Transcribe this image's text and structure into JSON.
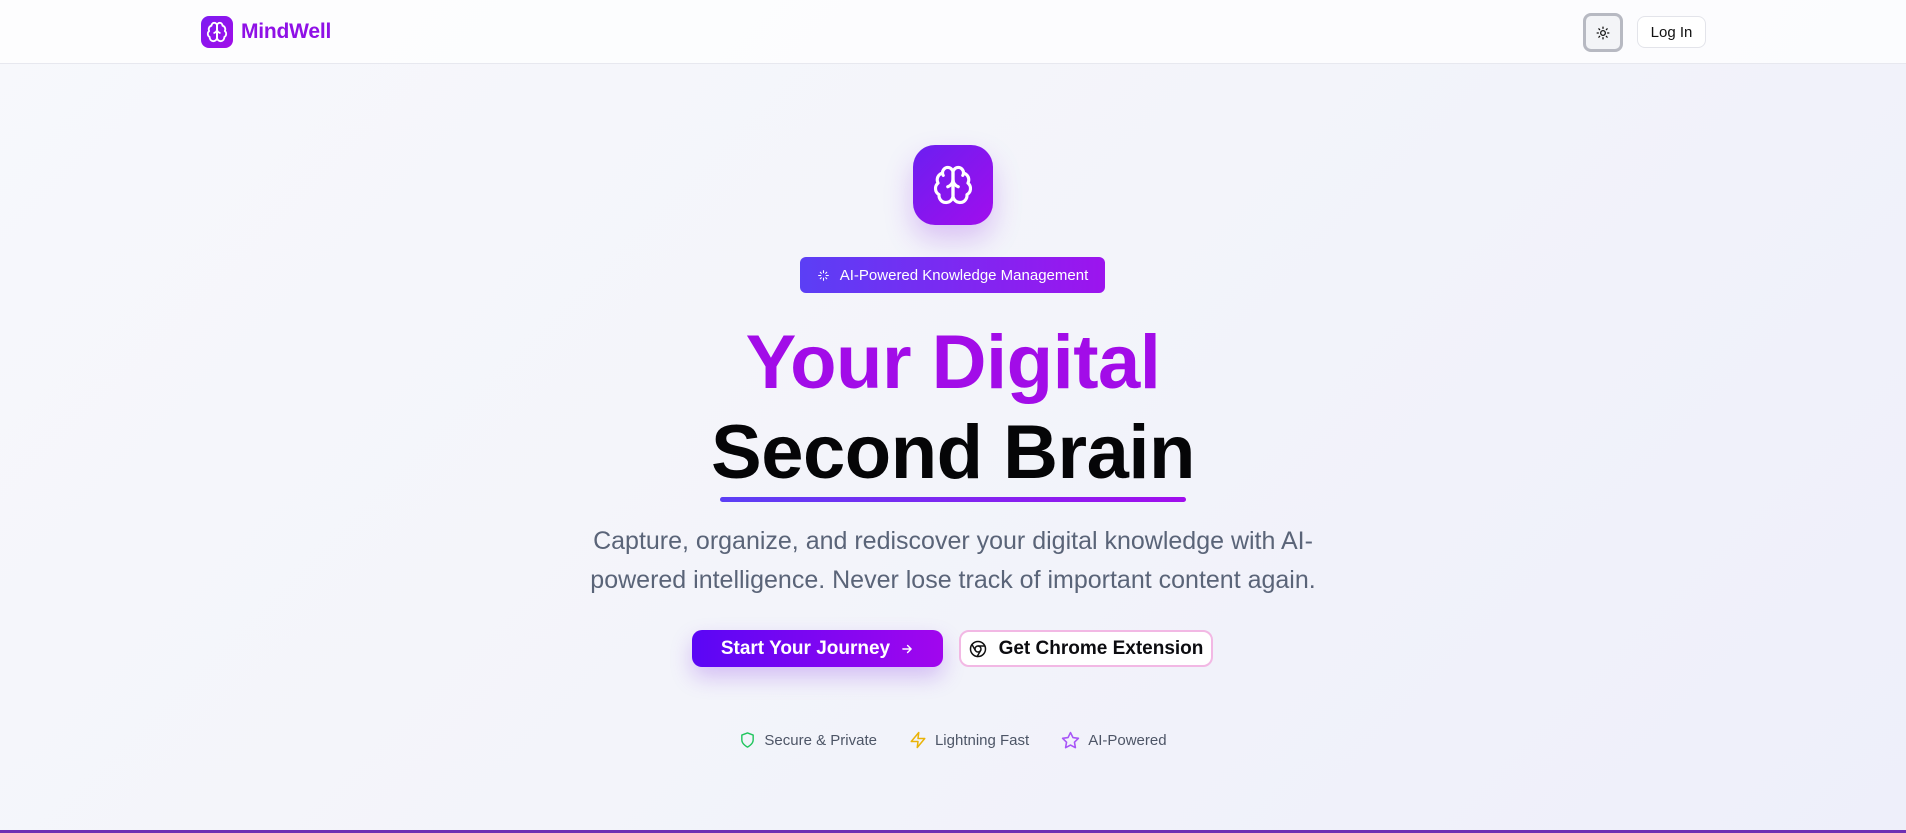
{
  "header": {
    "brand_name": "MindWell",
    "brand_icon": "brain-icon",
    "theme_toggle_icon": "sun-icon",
    "login_label": "Log In"
  },
  "hero": {
    "icon": "brain-icon",
    "badge_icon": "sparkles-icon",
    "badge_label": "AI-Powered Knowledge Management",
    "headline_line1": "Your Digital",
    "headline_line2": "Second Brain",
    "subtext": "Capture, organize, and rediscover your digital knowledge with AI-powered intelligence. Never lose track of important content again.",
    "primary_cta": {
      "label": "Start Your Journey",
      "icon": "arrow-right-icon"
    },
    "secondary_cta": {
      "label": "Get Chrome Extension",
      "icon": "chrome-icon"
    }
  },
  "features": [
    {
      "label": "Secure & Private",
      "icon": "shield-icon",
      "color": "#22c55e"
    },
    {
      "label": "Lightning Fast",
      "icon": "zap-icon",
      "color": "#eab308"
    },
    {
      "label": "AI-Powered",
      "icon": "star-icon",
      "color": "#a855f7"
    }
  ],
  "colors": {
    "brand": "#8f10e6",
    "accent_start": "#5a06f5",
    "accent_end": "#a106ee"
  }
}
